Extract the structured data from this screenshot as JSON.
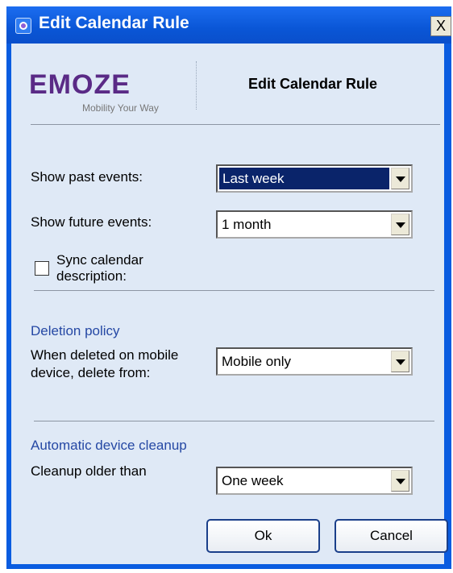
{
  "window": {
    "title": "Edit Calendar Rule",
    "close_label": "X"
  },
  "header": {
    "logo_text": "EMOZE",
    "logo_tagline": "Mobility Your Way",
    "title": "Edit Calendar Rule"
  },
  "form": {
    "past_events": {
      "label": "Show past events:",
      "value": "Last week"
    },
    "future_events": {
      "label": "Show future events:",
      "value": "1 month"
    },
    "sync_description": {
      "label": "Sync calendar description:",
      "checked": false
    }
  },
  "deletion": {
    "section_title": "Deletion policy",
    "label": "When deleted on mobile device, delete from:",
    "value": "Mobile only"
  },
  "cleanup": {
    "section_title": "Automatic device cleanup",
    "label": "Cleanup older than",
    "value": "One week"
  },
  "buttons": {
    "ok": "Ok",
    "cancel": "Cancel"
  },
  "colors": {
    "titlebar": "#0a5ce0",
    "background": "#dfe9f6",
    "section": "#2548a4"
  }
}
